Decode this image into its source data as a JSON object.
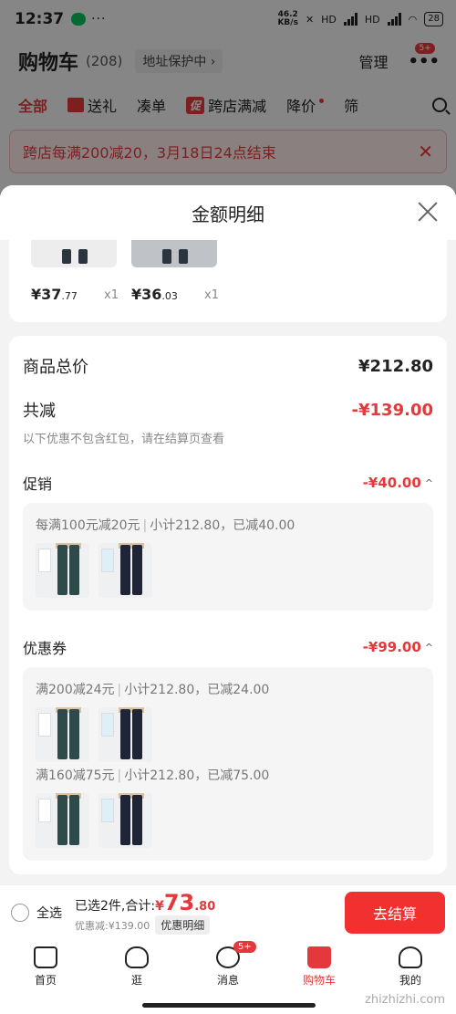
{
  "status_bar": {
    "time": "12:37",
    "dots": "···",
    "net_speed_value": "46.2",
    "net_speed_unit": "KB/s",
    "hd1": "HD",
    "hd2": "HD",
    "battery": "28"
  },
  "cart_header": {
    "title": "购物车",
    "count": "(208)",
    "address_protect": "地址保护中 ›",
    "manage": "管理",
    "more_badge": "5+"
  },
  "tabs": [
    {
      "label": "全部"
    },
    {
      "label": "送礼"
    },
    {
      "label": "凑单"
    },
    {
      "tag": "促",
      "label": "跨店满减"
    },
    {
      "label": "降价"
    },
    {
      "label": "筛"
    }
  ],
  "banner": {
    "text": "跨店每满200减20，3月18日24点结束",
    "close": "✕"
  },
  "sheet": {
    "title": "金额明细",
    "items": [
      {
        "price_int": "¥37",
        "price_dec": ".77",
        "qty": "x1"
      },
      {
        "price_int": "¥36",
        "price_dec": ".03",
        "qty": "x1"
      }
    ],
    "total_label": "商品总价",
    "total_value": "¥212.80",
    "reduce_label": "共减",
    "reduce_value": "-¥139.00",
    "note": "以下优惠不包含红包，请在结算页查看",
    "promo": {
      "label": "促销",
      "value": "-¥40.00",
      "line": {
        "a": "每满100元减20元",
        "sep": "|",
        "b": "小计212.80，已减40.00"
      }
    },
    "coupon": {
      "label": "优惠券",
      "value": "-¥99.00",
      "lines": [
        {
          "a": "满200减24元",
          "sep": "|",
          "b": "小计212.80，已减24.00"
        },
        {
          "a": "满160减75元",
          "sep": "|",
          "b": "小计212.80，已减75.00"
        }
      ]
    }
  },
  "checkout": {
    "select_all": "全选",
    "selected_prefix": "已选2件,合计:",
    "yen": "¥",
    "amount_int": "73",
    "amount_dec": ".80",
    "discount": "优惠减:¥139.00",
    "detail_button": "优惠明细",
    "pay_button": "去结算"
  },
  "bottom_nav": [
    {
      "label": "首页"
    },
    {
      "label": "逛"
    },
    {
      "label": "消息",
      "badge": "5+"
    },
    {
      "label": "购物车"
    },
    {
      "label": "我的"
    }
  ],
  "watermark": "zhizhizhi.com",
  "colors": {
    "accent": "#e4393c",
    "pay": "#f23030"
  }
}
